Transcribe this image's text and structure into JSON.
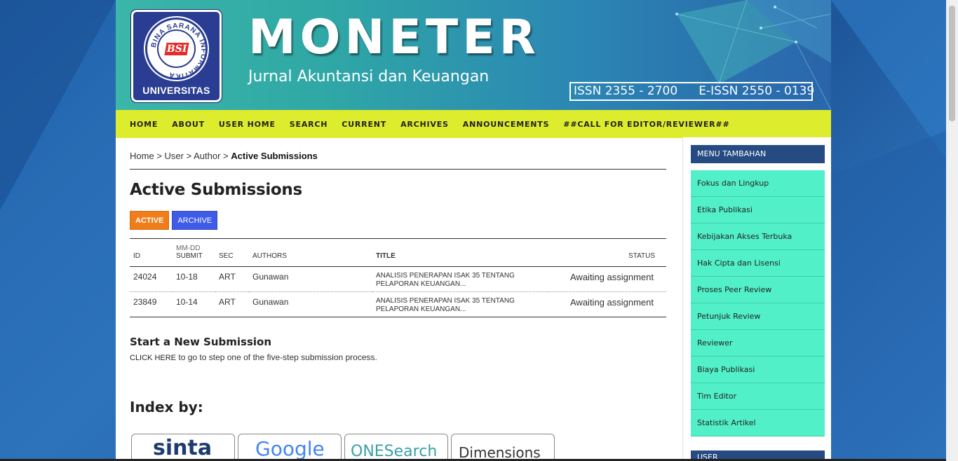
{
  "header": {
    "logo_text": "UNIVERSITAS",
    "logo_ring_text": "BINA SARANA INFORMATIKA",
    "logo_emblem": "BSI",
    "brand": "MONETER",
    "tagline": "Jurnal Akuntansi dan Keuangan",
    "issn": "ISSN 2355 - 2700",
    "eissn": "E-ISSN 2550 - 0139"
  },
  "nav": [
    "HOME",
    "ABOUT",
    "USER HOME",
    "SEARCH",
    "CURRENT",
    "ARCHIVES",
    "ANNOUNCEMENTS",
    "##CALL FOR EDITOR/REVIEWER##"
  ],
  "breadcrumb": {
    "home": "Home",
    "user": "User",
    "author": "Author",
    "current": "Active Submissions",
    "sep": ">"
  },
  "page_title": "Active Submissions",
  "tabs": {
    "active": "ACTIVE",
    "archive": "ARCHIVE"
  },
  "table": {
    "headers": {
      "id": "ID",
      "mmdd": "MM-DD",
      "submit": "SUBMIT",
      "sec": "SEC",
      "authors": "AUTHORS",
      "title": "TITLE",
      "status": "STATUS"
    },
    "rows": [
      {
        "id": "24024",
        "date": "10-18",
        "sec": "ART",
        "author": "Gunawan",
        "title": "ANALISIS PENERAPAN ISAK 35 TENTANG PELAPORAN KEUANGAN...",
        "status": "Awaiting assignment"
      },
      {
        "id": "23849",
        "date": "10-14",
        "sec": "ART",
        "author": "Gunawan",
        "title": "ANALISIS PENERAPAN ISAK 35 TENTANG PELAPORAN KEUANGAN...",
        "status": "Awaiting assignment"
      }
    ]
  },
  "new_submission": {
    "heading": "Start a New Submission",
    "link": "CLICK HERE",
    "text": " to go to step one of the five-step submission process."
  },
  "index_by": {
    "heading": "Index by:",
    "logos": [
      "sinta",
      "Google",
      "ONESearch",
      "Dimensions"
    ]
  },
  "sidebar": {
    "heading": "MENU TAMBAHAN",
    "items": [
      "Fokus dan Lingkup",
      "Etika Publikasi",
      "Kebijakan Akses Terbuka",
      "Hak Cipta dan Lisensi",
      "Proses Peer Review",
      "Petunjuk Review",
      "Reviewer",
      "Biaya Publikasi",
      "Tim Editor",
      "Statistik Artikel"
    ],
    "heading2": "USER"
  },
  "colors": {
    "nav_bg": "#ddec2c",
    "menu_item_bg": "#52f0c8",
    "sidebar_heading_bg": "#264a82",
    "active_tab": "#ef7d19",
    "archive_tab": "#3f5be8"
  }
}
